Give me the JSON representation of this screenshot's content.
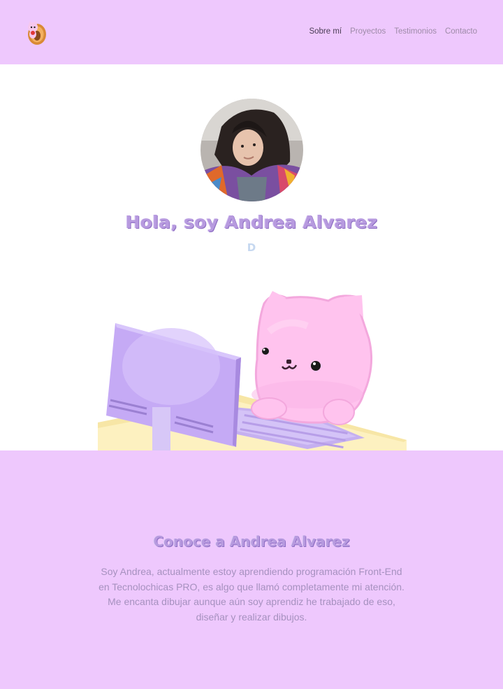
{
  "header": {
    "logo_icon": "cat-in-donut-logo-icon",
    "nav": {
      "items": [
        {
          "label": "Sobre mí",
          "active": true
        },
        {
          "label": "Proyectos",
          "active": false
        },
        {
          "label": "Testimonios",
          "active": false
        },
        {
          "label": "Contacto",
          "active": false
        }
      ]
    },
    "bg_color": "#eec8fd"
  },
  "hero": {
    "title": "Hola, soy Andrea Alvarez",
    "typing_text": "D",
    "avatar_icon": "profile-photo",
    "illustration_icon": "pink-cat-at-computer-illustration",
    "title_color": "#b79adf"
  },
  "about": {
    "title": "Conoce a Andrea Alvarez",
    "text": "Soy Andrea, actualmente estoy aprendiendo programación Front-End en Tecnolochicas PRO, es algo que llamó completamente mi atención. Me encanta dibujar aunque aún soy aprendiz he trabajado de eso, diseñar y realizar dibujos.",
    "bg_color": "#eec8fd",
    "text_color": "#a691bf"
  }
}
